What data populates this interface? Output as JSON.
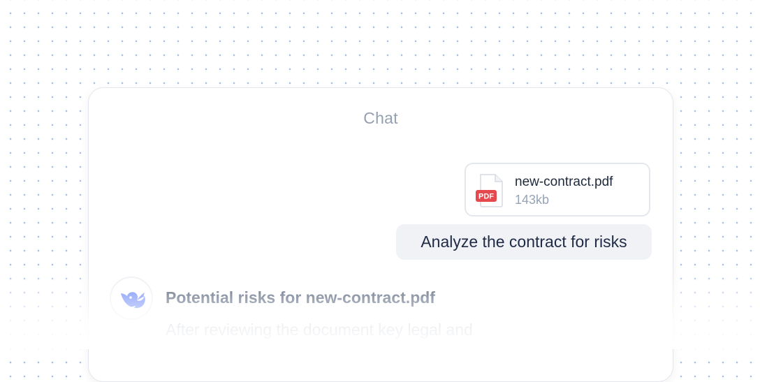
{
  "chat": {
    "title": "Chat"
  },
  "attachment": {
    "badge": "PDF",
    "name": "new-contract.pdf",
    "size": "143kb",
    "icon": "pdf-file-icon",
    "badge_color": "#e5484d"
  },
  "user_message": {
    "text": "Analyze the contract for risks"
  },
  "assistant": {
    "avatar_icon": "whale-icon",
    "accent_color": "#5b7cf6",
    "title": "Potential risks for new-contract.pdf",
    "body": "After reviewing the document key legal and"
  }
}
